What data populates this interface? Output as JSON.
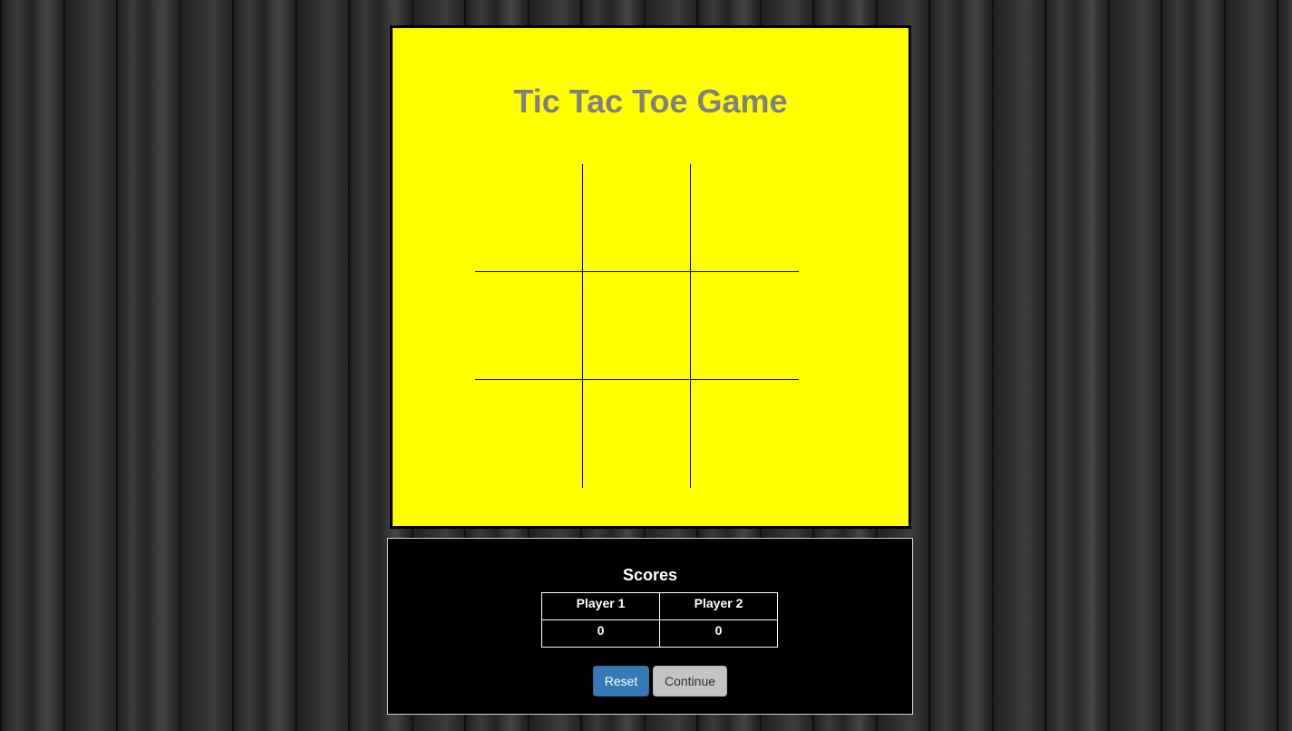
{
  "game": {
    "title": "Tic Tac Toe Game",
    "background_color": "#ffff00",
    "board": [
      [
        "",
        "",
        ""
      ],
      [
        "",
        "",
        ""
      ],
      [
        "",
        "",
        ""
      ]
    ]
  },
  "scores": {
    "title": "Scores",
    "headers": [
      "Player 1",
      "Player 2"
    ],
    "values": [
      "0",
      "0"
    ]
  },
  "buttons": {
    "reset_label": "Reset",
    "continue_label": "Continue"
  },
  "colors": {
    "title_text": "#808080",
    "reset_button": "#337ab7",
    "continue_button": "#c4c4c4"
  }
}
